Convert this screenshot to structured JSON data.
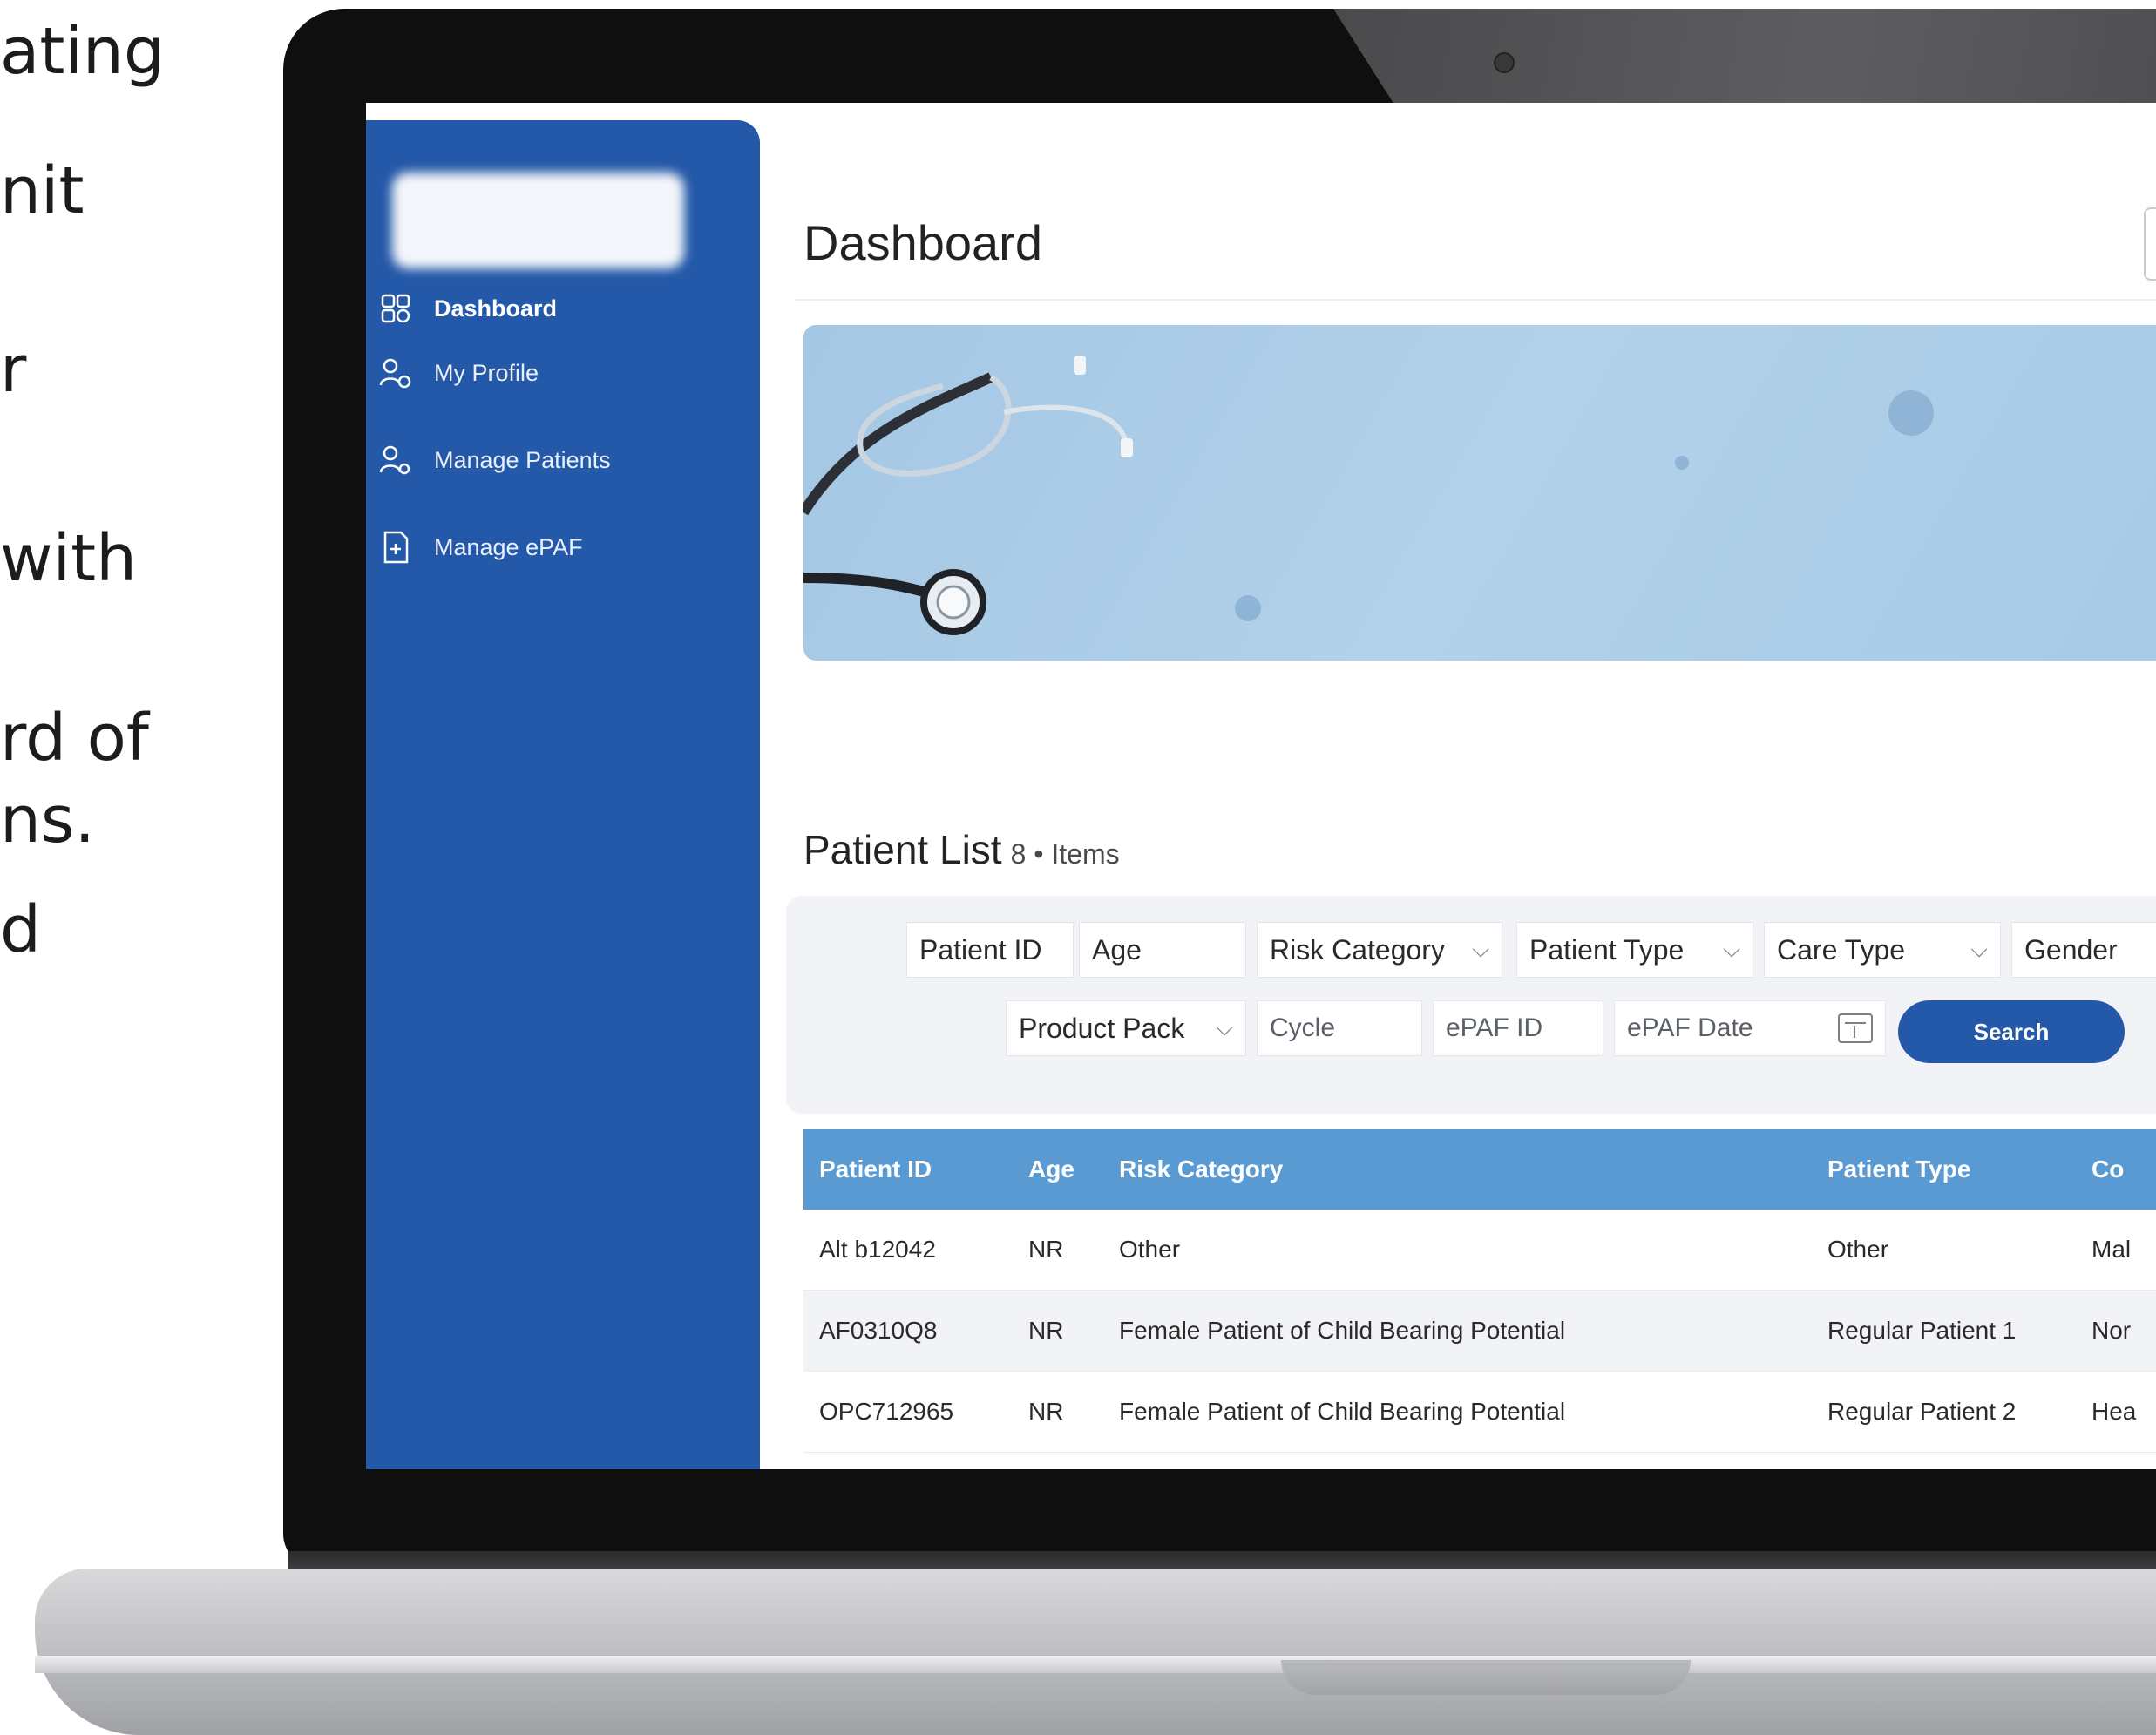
{
  "side_text": [
    "ating",
    "nit",
    "r",
    "with",
    "rd of",
    "ns.",
    "d"
  ],
  "sidebar": {
    "items": [
      {
        "label": "Dashboard",
        "icon": "dashboard-icon"
      },
      {
        "label": "My Profile",
        "icon": "user-icon"
      },
      {
        "label": "Manage Patients",
        "icon": "users-icon"
      },
      {
        "label": "Manage ePAF",
        "icon": "document-icon"
      }
    ]
  },
  "header": {
    "title": "Dashboard"
  },
  "banner": {
    "image": "stethoscope-illustration"
  },
  "patient_list": {
    "title": "Patient List",
    "subtitle": "8 • Items"
  },
  "filters": {
    "row1": [
      {
        "label": "Patient ID",
        "type": "input"
      },
      {
        "label": "Age",
        "type": "input"
      },
      {
        "label": "Risk Category",
        "type": "select"
      },
      {
        "label": "Patient Type",
        "type": "select"
      },
      {
        "label": "Care Type",
        "type": "select"
      },
      {
        "label": "Gender",
        "type": "select"
      }
    ],
    "row2": [
      {
        "label": "Product Pack",
        "type": "select"
      },
      {
        "label": "Cycle",
        "type": "input"
      },
      {
        "label": "ePAF ID",
        "type": "input"
      },
      {
        "label": "ePAF Date",
        "type": "date"
      }
    ],
    "search_label": "Search"
  },
  "table": {
    "columns": [
      "Patient ID",
      "Age",
      "Risk Category",
      "Patient Type",
      "Co"
    ],
    "rows": [
      [
        "Alt b12042",
        "NR",
        "Other",
        "Other",
        "Mal"
      ],
      [
        "AF0310Q8",
        "NR",
        "Female Patient of Child Bearing Potential",
        "Regular Patient 1",
        "Nor"
      ],
      [
        "OPC712965",
        "NR",
        "Female Patient of Child Bearing Potential",
        "Regular Patient 2",
        "Hea"
      ]
    ]
  },
  "colors": {
    "sidebar": "#2458a8",
    "table_header": "#5a9ad2",
    "banner": "#a8cbe6",
    "accent": "#2458a8"
  }
}
